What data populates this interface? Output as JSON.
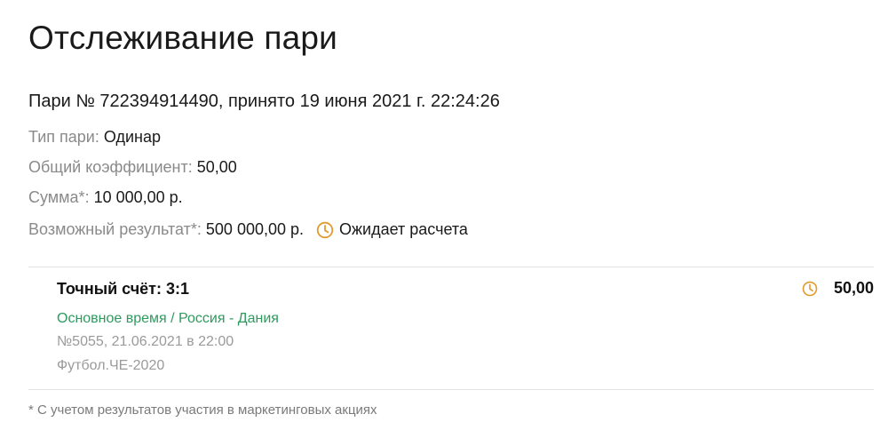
{
  "page": {
    "title": "Отслеживание пари"
  },
  "bet": {
    "header": "Пари № 722394914490, принято 19 июня 2021 г. 22:24:26",
    "type_label": "Тип пари:",
    "type_value": "Одинар",
    "coef_label": "Общий коэффициент:",
    "coef_value": "50,00",
    "sum_label": "Сумма*:",
    "sum_value": "10 000,00 р.",
    "result_label": "Возможный результат*:",
    "result_value": "500 000,00 р.",
    "status_text": "Ожидает расчета",
    "status_icon": "clock-icon",
    "status_color": "#e39a2e"
  },
  "event": {
    "name": "Точный счёт: 3:1",
    "odds": "50,00",
    "period": "Основное время / Россия - Дания",
    "meta": "№5055, 21.06.2021 в 22:00",
    "league": "Футбол.ЧЕ-2020",
    "period_color": "#2e9a5e"
  },
  "footnote": "* С учетом результатов участия в маркетинговых акциях"
}
